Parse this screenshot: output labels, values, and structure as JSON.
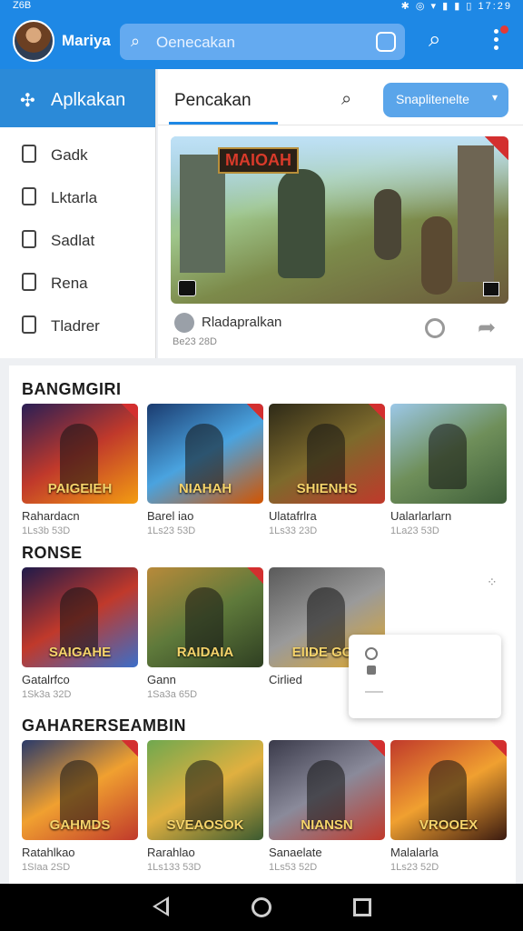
{
  "status_bar": {
    "left_text": "Z6B",
    "right_text": "✱ ◎ ▾ ▮ ▮ ▯ 17:29"
  },
  "header": {
    "username": "Mariya",
    "search_placeholder": "Oenecakan",
    "search_icon": "search-icon",
    "menu_icon": "kebab-menu-icon"
  },
  "sidebar": {
    "header_label": "Aplkakan",
    "items": [
      {
        "label": "Gadk",
        "icon": "bookmark-icon"
      },
      {
        "label": "Lktarla",
        "icon": "tag-icon"
      },
      {
        "label": "Sadlat",
        "icon": "square-icon"
      },
      {
        "label": "Rena",
        "icon": "square-icon"
      },
      {
        "label": "Tladrer",
        "icon": "square-icon"
      }
    ]
  },
  "tabs": {
    "active_label": "Pencakan",
    "filter_label": "Snaplitenelte"
  },
  "featured": {
    "art_title": "MAIOAH",
    "name": "Rladapralkan",
    "meta": "Be23 28D"
  },
  "sections": [
    {
      "title": "BANGMGIRI",
      "cards": [
        {
          "art_title": "PAIGEIEH",
          "name": "Rahardacn",
          "meta": "1Ls3b 53D",
          "colors": [
            "#2a1f55",
            "#c0392b",
            "#f39c12"
          ]
        },
        {
          "art_title": "NIAHAH",
          "name": "Barel iao",
          "meta": "1Ls23 53D",
          "colors": [
            "#1b3b6f",
            "#4aa3df",
            "#d35400"
          ]
        },
        {
          "art_title": "SHIENHS",
          "name": "Ulatafrlra",
          "meta": "1Ls33 23D",
          "colors": [
            "#2e2a18",
            "#7d6a2c",
            "#c0392b"
          ]
        },
        {
          "art_title": "",
          "name": "Ualarlarlarn",
          "meta": "1La23 53D",
          "colors": [
            "#9cc8e8",
            "#6f8f5a",
            "#3f5f3a"
          ]
        }
      ]
    },
    {
      "title": "RONSE",
      "cards": [
        {
          "art_title": "SAIGAHE",
          "name": "Gatalrfco",
          "meta": "1Sk3a 32D",
          "colors": [
            "#1f1a4a",
            "#c0392b",
            "#3b6ec9"
          ]
        },
        {
          "art_title": "RAIDAIA",
          "name": "Gann",
          "meta": "1Sa3a 65D",
          "colors": [
            "#b88a3a",
            "#5f7a3b",
            "#2f3f22"
          ]
        },
        {
          "art_title": "EIIDE GCU",
          "name": "Cirlied",
          "meta": "",
          "colors": [
            "#5a5a5a",
            "#9a9a9a",
            "#e0a82b"
          ]
        }
      ]
    },
    {
      "title": "GAHARERSEAMBIN",
      "cards": [
        {
          "art_title": "GAHMDS",
          "name": "Ratahlkao",
          "meta": "1SIaa 2SD",
          "colors": [
            "#2a3a6a",
            "#f0a030",
            "#c0392b"
          ]
        },
        {
          "art_title": "SVEAOSOK",
          "name": "Rarahlao",
          "meta": "1Ls133 53D",
          "colors": [
            "#6fa84f",
            "#e0b040",
            "#3a5a30"
          ]
        },
        {
          "art_title": "NIANSN",
          "name": "Sanaelate",
          "meta": "1Ls53 52D",
          "colors": [
            "#3a3a4a",
            "#8a8a9a",
            "#c0392b"
          ]
        },
        {
          "art_title": "VROOEX",
          "name": "Malalarla",
          "meta": "1Ls23 52D",
          "colors": [
            "#c0392b",
            "#f0a030",
            "#3a1a10"
          ]
        }
      ]
    }
  ],
  "colors": {
    "primary": "#1e88e5",
    "sidebar_active": "#2b8ad8",
    "ribbon": "#d32f2f"
  }
}
